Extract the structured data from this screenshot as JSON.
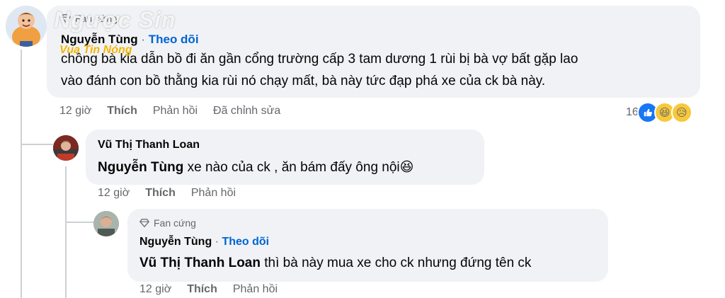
{
  "comments": [
    {
      "badge": "Fan cứng",
      "author": "Nguyễn Tùng",
      "separator": " · ",
      "follow_label": "Theo dõi",
      "text_line1": "chồng bà kia dẫn bồ đi ăn gần cổng trường cấp 3 tam dương 1 rùi bị bà vợ bất gặp lao",
      "text_line2": "vào đánh con bồ thằng kia rùi nó chạy mất, bà này tức đạp phá xe của ck bà này.",
      "time": "12 giờ",
      "like_label": "Thích",
      "reply_label": "Phản hồi",
      "edited_label": "Đã chỉnh sửa",
      "reaction_count": "16",
      "reactions": [
        "like",
        "haha",
        "sad"
      ]
    },
    {
      "author": "Vũ Thị Thanh Loan",
      "mention": "Nguyễn Tùng",
      "text": " xe nào của ck , ăn bám đấy ông nội",
      "emoji": "😆",
      "time": "12 giờ",
      "like_label": "Thích",
      "reply_label": "Phản hồi"
    },
    {
      "badge": "Fan cứng",
      "author": "Nguyễn Tùng",
      "separator": " · ",
      "follow_label": "Theo dõi",
      "mention": "Vũ Thị Thanh Loan",
      "text": " thì bà này mua xe cho ck nhưng đứng tên ck",
      "time": "12 giờ",
      "like_label": "Thích",
      "reply_label": "Phản hồi"
    }
  ],
  "watermark": {
    "line1": "Ngược Sin",
    "line2": "Vua Tin Nóng"
  },
  "colors": {
    "bubble": "#f0f2f5",
    "link": "#0064d1",
    "meta": "#65676b",
    "like": "#1877f2",
    "thread": "#ced0d4"
  }
}
